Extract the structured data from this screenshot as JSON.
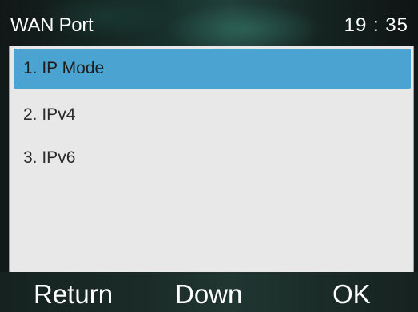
{
  "header": {
    "title": "WAN Port",
    "time": "19 : 35"
  },
  "menu": {
    "items": [
      {
        "label": "1. IP Mode",
        "selected": true
      },
      {
        "label": "2. IPv4",
        "selected": false
      },
      {
        "label": "3. IPv6",
        "selected": false
      }
    ]
  },
  "softkeys": {
    "return_label": "Return",
    "down_label": "Down",
    "ok_label": "OK"
  },
  "colors": {
    "selection": "#4aa3d1",
    "panel": "#e8e8e8",
    "header_bg": "#1b3530"
  }
}
